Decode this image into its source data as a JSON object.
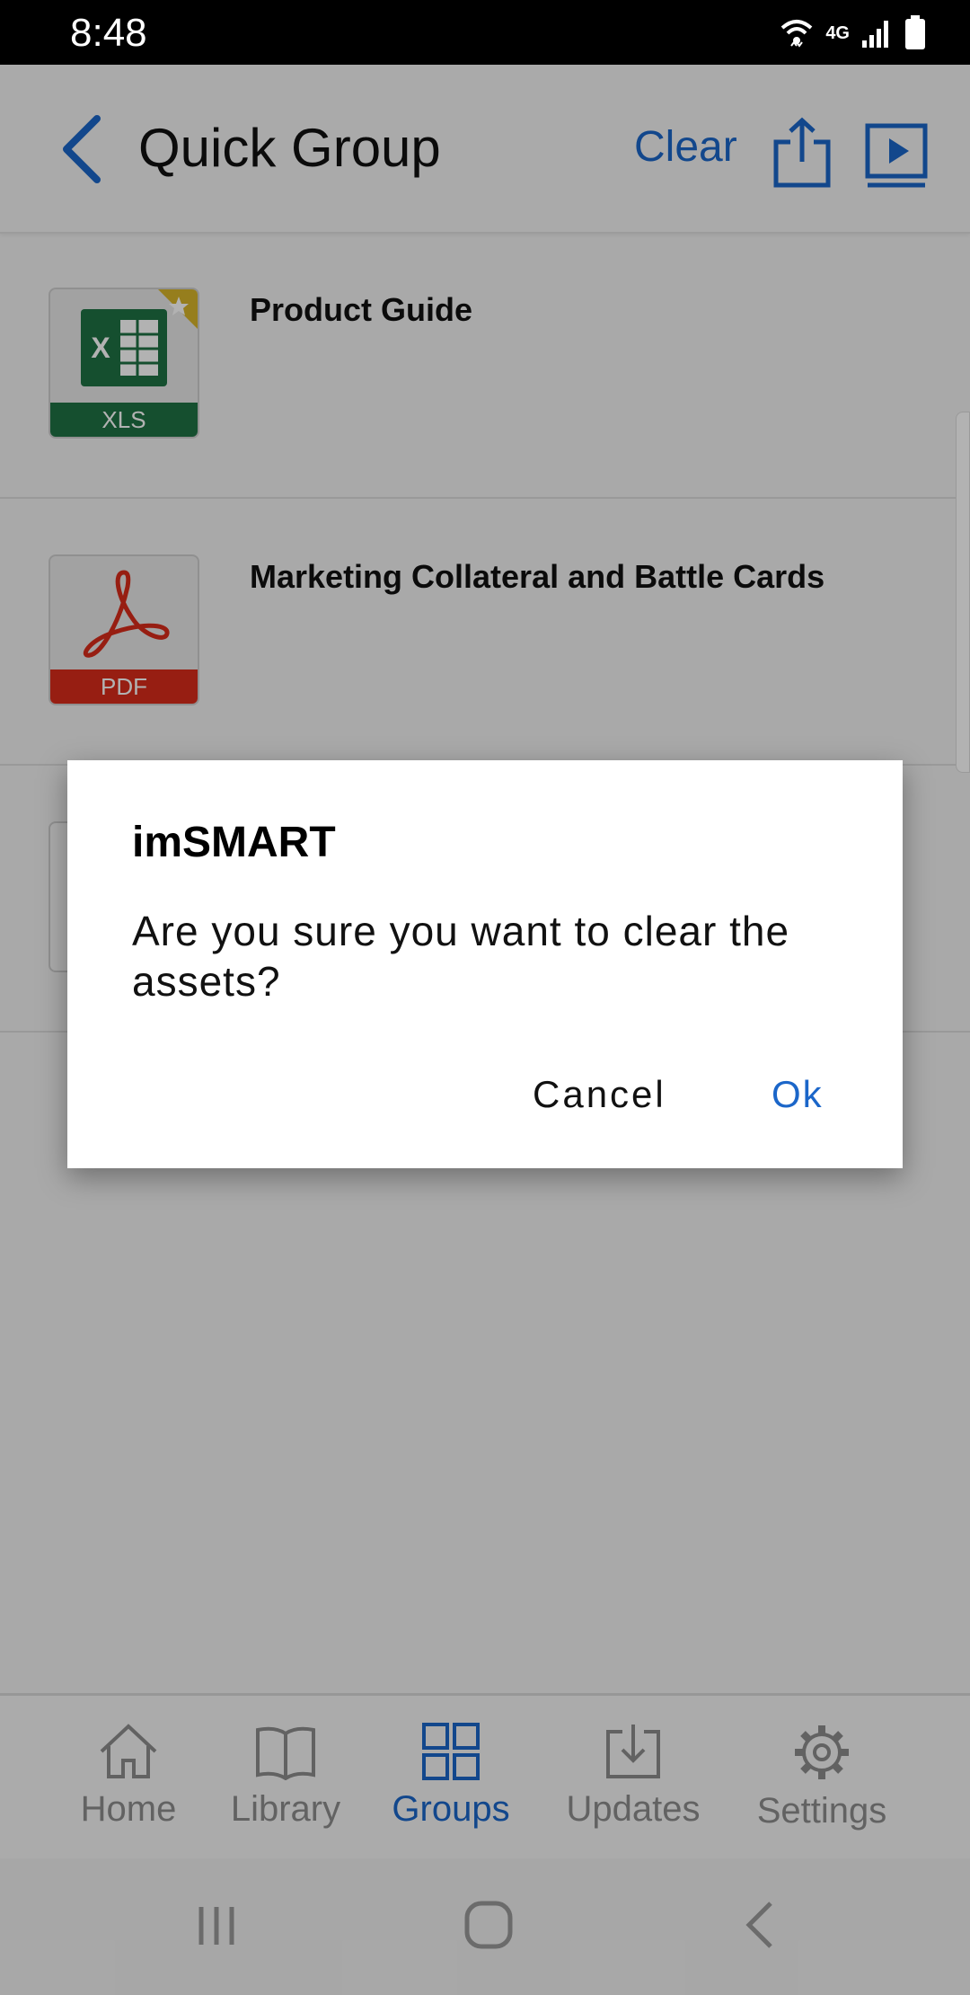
{
  "status_bar": {
    "time": "8:48",
    "network": "4G"
  },
  "header": {
    "title": "Quick Group",
    "clear_label": "Clear"
  },
  "list": {
    "items": [
      {
        "name": "Product Guide",
        "type": "XLS",
        "starred": true
      },
      {
        "name": "Marketing Collateral and Battle Cards",
        "type": "PDF",
        "starred": false
      }
    ]
  },
  "bottom_nav": {
    "tabs": [
      {
        "label": "Home",
        "icon": "home-icon"
      },
      {
        "label": "Library",
        "icon": "book-icon"
      },
      {
        "label": "Groups",
        "icon": "grid-icon",
        "active": true
      },
      {
        "label": "Updates",
        "icon": "download-icon"
      },
      {
        "label": "Settings",
        "icon": "gear-icon"
      }
    ]
  },
  "dialog": {
    "title": "imSMART",
    "message": "Are you sure you want to clear the assets?",
    "cancel_label": "Cancel",
    "ok_label": "Ok"
  },
  "colors": {
    "accent": "#1b66c9",
    "xls_green": "#1f7144",
    "pdf_red": "#d92b1a"
  }
}
